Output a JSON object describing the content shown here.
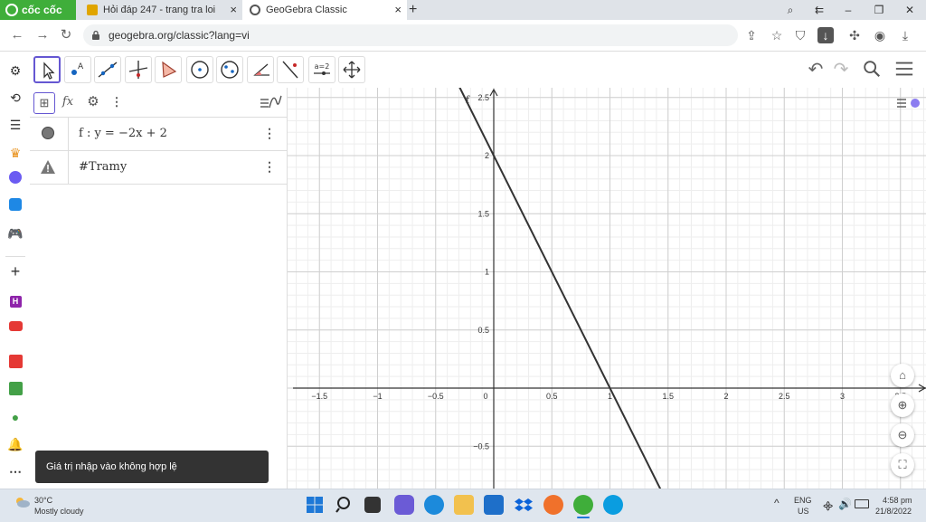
{
  "browser": {
    "brand": "cốc cốc",
    "tabs": [
      {
        "title": "Hỏi đáp 247 - trang tra loi",
        "close": "×"
      },
      {
        "title": "GeoGebra Classic",
        "close": "×"
      }
    ],
    "new_tab": "+",
    "window_buttons": {
      "minimize": "–",
      "maximize": "❐",
      "close": "✕"
    },
    "url": "geogebra.org/classic?lang=vi"
  },
  "algebra": {
    "items": [
      {
        "text": "f : y = −2x + 2"
      },
      {
        "text": "#Tramy"
      }
    ],
    "menu_glyph": "⋮"
  },
  "toolbar": {
    "slider_label": "a=2"
  },
  "toast": {
    "message": "Giá trị nhập vào không hợp lệ"
  },
  "graph": {
    "function_label": "f",
    "x_ticks": [
      "−1.5",
      "−1",
      "−0.5",
      "0",
      "0.5",
      "1",
      "1.5",
      "2",
      "2.5",
      "3",
      "3.5"
    ],
    "y_ticks": [
      "2.5",
      "2",
      "1.5",
      "1",
      "0.5",
      "−0.5"
    ]
  },
  "taskbar": {
    "weather": {
      "temp": "30°C",
      "desc": "Mostly cloudy"
    },
    "lang": {
      "line1": "ENG",
      "line2": "US"
    },
    "clock": {
      "time": "4:58 pm",
      "date": "21/8/2022"
    },
    "chevron": "^"
  },
  "colors": {
    "browser_brand": "#3fae3a",
    "selected_tool_border": "#6557d2",
    "graph_line": "#333333",
    "toast_bg": "#333333"
  }
}
